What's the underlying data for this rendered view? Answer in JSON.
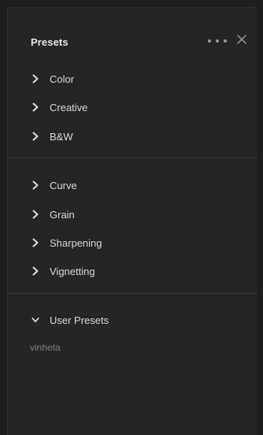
{
  "panel": {
    "title": "Presets"
  },
  "groups_section1": [
    {
      "label": "Color"
    },
    {
      "label": "Creative"
    },
    {
      "label": "B&W"
    }
  ],
  "groups_section2": [
    {
      "label": "Curve"
    },
    {
      "label": "Grain"
    },
    {
      "label": "Sharpening"
    },
    {
      "label": "Vignetting"
    }
  ],
  "user_presets": {
    "label": "User Presets",
    "expanded": true,
    "items": [
      {
        "label": "vinheta"
      }
    ]
  },
  "icons": {
    "more": "more-horizontal-icon",
    "close": "close-icon",
    "collapsed": "chevron-right-icon",
    "expanded": "chevron-down-icon"
  }
}
